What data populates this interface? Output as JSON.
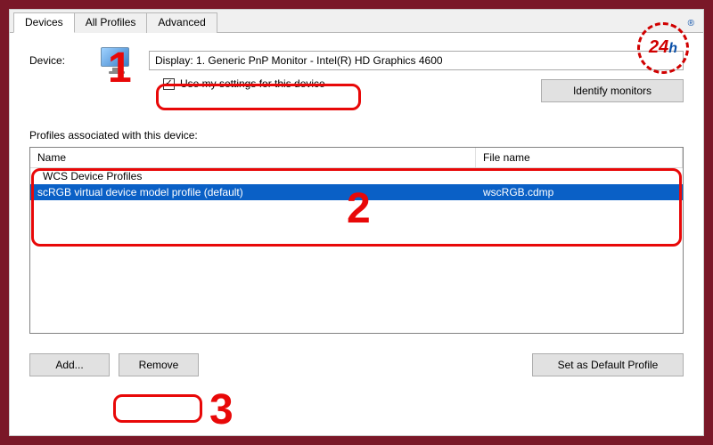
{
  "tabs": {
    "devices": "Devices",
    "all_profiles": "All Profiles",
    "advanced": "Advanced"
  },
  "device": {
    "label": "Device:",
    "selected": "Display: 1. Generic PnP Monitor - Intel(R) HD Graphics 4600",
    "use_settings_label": "Use my settings for this device",
    "identify_button": "Identify monitors"
  },
  "profiles": {
    "section_label": "Profiles associated with this device:",
    "columns": {
      "name": "Name",
      "file": "File name"
    },
    "group": "WCS Device Profiles",
    "items": [
      {
        "name": "scRGB virtual device model profile (default)",
        "file": "wscRGB.cdmp"
      }
    ]
  },
  "buttons": {
    "add": "Add...",
    "remove": "Remove",
    "set_default": "Set as Default Profile"
  },
  "annotations": {
    "step1": "1",
    "step2": "2",
    "step3": "3"
  },
  "badge": {
    "text": "24",
    "suffix": "h",
    "reg": "®"
  }
}
